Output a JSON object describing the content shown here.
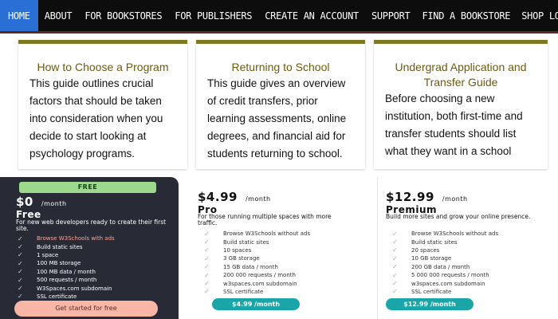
{
  "nav": {
    "items": [
      "HOME",
      "ABOUT",
      "FOR BOOKSTORES",
      "FOR PUBLISHERS",
      "CREATE AN ACCOUNT",
      "SUPPORT",
      "FIND A BOOKSTORE",
      "SHOP LOCAL"
    ],
    "active": "HOME"
  },
  "guides": [
    {
      "title": "How to Choose a Program",
      "body": "This guide outlines crucial factors that should be taken into consideration when you decide to start looking at psychology programs."
    },
    {
      "title": "Returning to School",
      "body": "This guide gives an overview of credit transfers, prior learning assessments, online degrees, and financial aid for students returning to school."
    },
    {
      "title": "Undergrad Application and Transfer Guide",
      "body": "Before choosing a new institution, both first-time and transfer students should list what they want in a school"
    }
  ],
  "plans": [
    {
      "badge": "FREE",
      "price": "$0",
      "period": "/month",
      "name": "Free",
      "description": "For new web developers ready to create their first site.",
      "features": [
        "Browse W3Schools with ads",
        "Build static sites",
        "1 space",
        "100 MB storage",
        "100 MB data / month",
        "500 requests / month",
        "W3Spaces.com subdomain",
        "SSL certificate"
      ],
      "button": "Get started for free"
    },
    {
      "price": "$4.99",
      "period": "/month",
      "name": "Pro",
      "description": "For those running multiple spaces with more traffic.",
      "features": [
        "Browse W3Schools without ads",
        "Build static sites",
        "10 spaces",
        "3 GB storage",
        "15 GB data / month",
        "200 000 requests / month",
        "w3spaces.com subdomain",
        "SSL certificate"
      ],
      "button": "$4.99 /month"
    },
    {
      "price": "$12.99",
      "period": "/month",
      "name": "Premium",
      "description": "Build more sites and grow your online presence.",
      "features": [
        "Browse W3Schools without ads",
        "Build static sites",
        "20 spaces",
        "10 GB storage",
        "200 GB data / month",
        "5 000 000 requests / month",
        "w3spaces.com subdomain",
        "SSL certificate"
      ],
      "button": "$12.99 /month"
    }
  ],
  "colors": {
    "nav_bg": "#0d0d0d",
    "nav_active": "#2a6fd6",
    "card_accent": "#7d7a21",
    "card_title": "#6b5a12",
    "free_bg": "#282a35",
    "free_badge": "#9cd98d",
    "free_button": "#f9b5a6",
    "paid_button": "#1aa6a8"
  },
  "icons": {
    "feature_check": "check-icon"
  }
}
